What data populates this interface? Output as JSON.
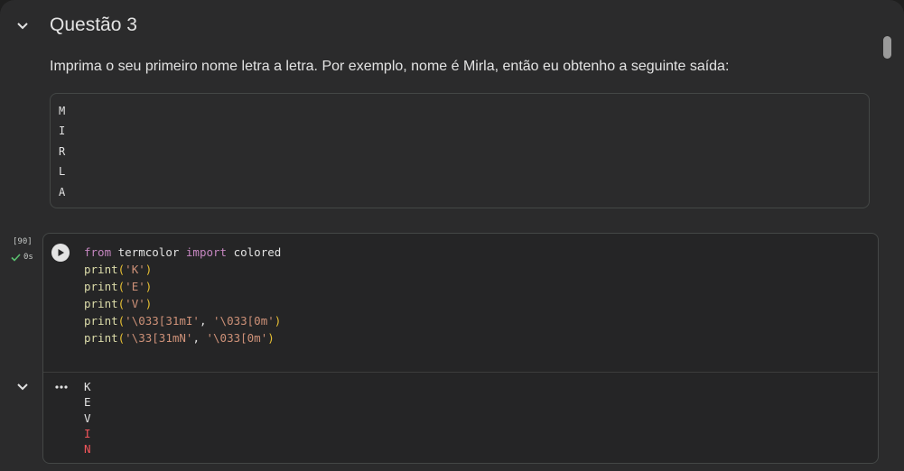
{
  "section": {
    "title": "Questão 3",
    "description": "Imprima o seu primeiro nome letra a letra. Por exemplo, nome é Mirla, então eu obtenho a seguinte saída:"
  },
  "example_output": [
    "M",
    "I",
    "R",
    "L",
    "A"
  ],
  "cell": {
    "execution_count": "[90]",
    "duration": "0s",
    "code": {
      "line1": {
        "kw1": "from",
        "mod": " termcolor ",
        "kw2": "import",
        "name": " colored"
      },
      "line2": {
        "fn": "print",
        "open": "(",
        "arg": "'K'",
        "close": ")"
      },
      "line3": {
        "fn": "print",
        "open": "(",
        "arg": "'E'",
        "close": ")"
      },
      "line4": {
        "fn": "print",
        "open": "(",
        "arg": "'V'",
        "close": ")"
      },
      "line5": {
        "fn": "print",
        "open": "(",
        "arg1": "'\\033[31mI'",
        "sep": ", ",
        "arg2": "'\\033[0m'",
        "close": ")"
      },
      "line6": {
        "fn": "print",
        "open": "(",
        "arg1": "'\\33[31mN'",
        "sep": ", ",
        "arg2": "'\\033[0m'",
        "close": ")"
      }
    },
    "output": [
      {
        "text": "K",
        "color": "#e3e3e3"
      },
      {
        "text": "E",
        "color": "#e3e3e3"
      },
      {
        "text": "V",
        "color": "#e3e3e3"
      },
      {
        "text": "I",
        "color": "#f2555a"
      },
      {
        "text": "N",
        "color": "#f2555a"
      }
    ]
  },
  "colors": {
    "background": "#2b2b2c",
    "success": "#5ac06f",
    "error_red": "#f2555a"
  },
  "icons": {
    "collapse": "chevron-down-icon",
    "run": "play-circle-icon",
    "status": "check-icon",
    "output_menu": "more-horiz-icon"
  }
}
